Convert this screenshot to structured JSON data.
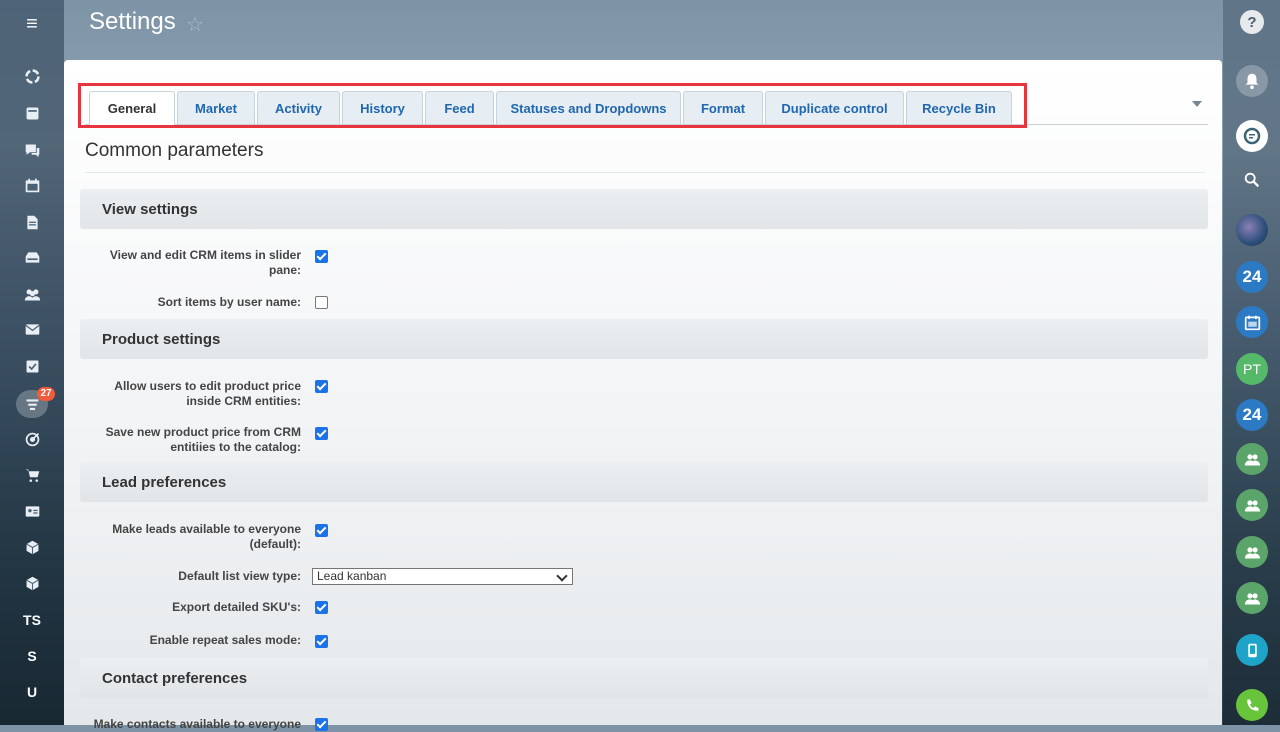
{
  "page": {
    "title": "Settings"
  },
  "left_nav": {
    "badge_count": "27",
    "initials": [
      "TS",
      "S",
      "U"
    ]
  },
  "right_bar": {
    "help": "?",
    "b24_1": "24",
    "pt_initials": "PT",
    "b24_2": "24"
  },
  "tabs": [
    {
      "label": "General",
      "active": true
    },
    {
      "label": "Market"
    },
    {
      "label": "Activity"
    },
    {
      "label": "History"
    },
    {
      "label": "Feed"
    },
    {
      "label": "Statuses and Dropdowns"
    },
    {
      "label": "Format"
    },
    {
      "label": "Duplicate control"
    },
    {
      "label": "Recycle Bin"
    }
  ],
  "section_title": "Common parameters",
  "groups": {
    "view": {
      "title": "View settings",
      "rows": [
        {
          "label_l1": "View and edit CRM items in slider",
          "label_l2": "pane:",
          "checked": true
        },
        {
          "label_l1": "Sort items by user name:",
          "checked": false
        }
      ]
    },
    "product": {
      "title": "Product settings",
      "rows": [
        {
          "label_l1": "Allow users to edit product price",
          "label_l2": "inside CRM entities:",
          "checked": true
        },
        {
          "label_l1": "Save new product price from CRM",
          "label_l2": "entitiies to the catalog:",
          "checked": true
        }
      ]
    },
    "lead": {
      "title": "Lead preferences",
      "rows": [
        {
          "label_l1": "Make leads available to everyone",
          "label_l2": "(default):",
          "checked": true
        },
        {
          "label_l1": "Default list view type:",
          "select_value": "Lead kanban"
        },
        {
          "label_l1": "Export detailed SKU's:",
          "checked": true
        },
        {
          "label_l1": "Enable repeat sales mode:",
          "checked": true
        }
      ]
    },
    "contact": {
      "title": "Contact preferences",
      "rows": [
        {
          "label_l1": "Make contacts available to everyone",
          "checked": true
        }
      ]
    }
  },
  "colors": {
    "tab_text": "#2067b0",
    "checkbox": "#1a73e8",
    "highlight": "#e8343f"
  }
}
